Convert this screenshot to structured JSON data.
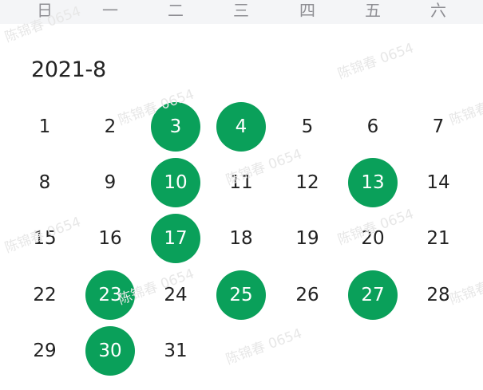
{
  "weekdays": [
    "日",
    "一",
    "二",
    "三",
    "四",
    "五",
    "六"
  ],
  "month_title": "2021-8",
  "watermark_text": "陈锦春 0654",
  "accent_color": "#0aa05a",
  "weeks": [
    [
      {
        "day": "1",
        "marked": false
      },
      {
        "day": "2",
        "marked": false
      },
      {
        "day": "3",
        "marked": true
      },
      {
        "day": "4",
        "marked": true
      },
      {
        "day": "5",
        "marked": false
      },
      {
        "day": "6",
        "marked": false
      },
      {
        "day": "7",
        "marked": false
      }
    ],
    [
      {
        "day": "8",
        "marked": false
      },
      {
        "day": "9",
        "marked": false
      },
      {
        "day": "10",
        "marked": true
      },
      {
        "day": "11",
        "marked": false
      },
      {
        "day": "12",
        "marked": false
      },
      {
        "day": "13",
        "marked": true
      },
      {
        "day": "14",
        "marked": false
      }
    ],
    [
      {
        "day": "15",
        "marked": false
      },
      {
        "day": "16",
        "marked": false
      },
      {
        "day": "17",
        "marked": true
      },
      {
        "day": "18",
        "marked": false
      },
      {
        "day": "19",
        "marked": false
      },
      {
        "day": "20",
        "marked": false
      },
      {
        "day": "21",
        "marked": false
      }
    ],
    [
      {
        "day": "22",
        "marked": false
      },
      {
        "day": "23",
        "marked": true
      },
      {
        "day": "24",
        "marked": false
      },
      {
        "day": "25",
        "marked": true
      },
      {
        "day": "26",
        "marked": false
      },
      {
        "day": "27",
        "marked": true
      },
      {
        "day": "28",
        "marked": false
      }
    ],
    [
      {
        "day": "29",
        "marked": false
      },
      {
        "day": "30",
        "marked": true
      },
      {
        "day": "31",
        "marked": false
      }
    ]
  ]
}
